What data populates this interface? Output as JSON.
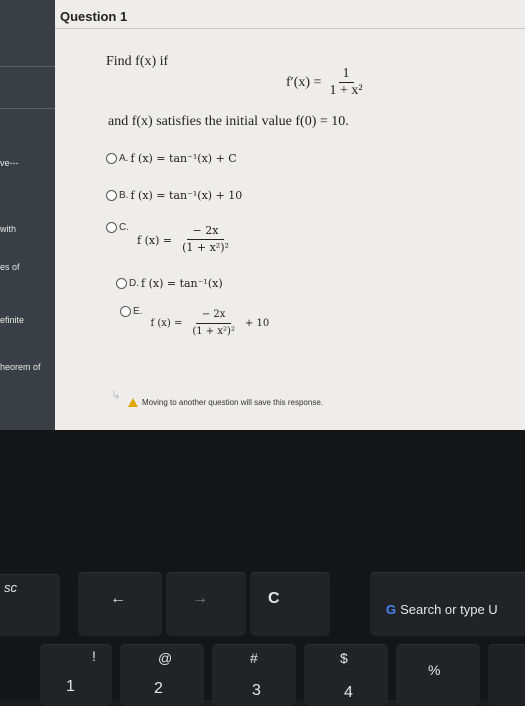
{
  "sidebar": {
    "items": [
      "ve---",
      "with",
      "es of",
      "efinite",
      "heorem of"
    ]
  },
  "question": {
    "title": "Question 1",
    "prompt": "Find f(x) if",
    "derivative_lhs": "f′(x) =",
    "derivative_num": "1",
    "derivative_den": "1 + x²",
    "condition": "and f(x) satisfies the initial value f(0) = 10."
  },
  "options": [
    {
      "letter": "A.",
      "expr": "f (x)  =  tan⁻¹(x)  +  C"
    },
    {
      "letter": "B.",
      "expr": "f (x)  =  tan⁻¹(x)  +  10"
    },
    {
      "letter": "C.",
      "lhs": "f (x)  =",
      "num": "− 2x",
      "den": "(1 + x²)²"
    },
    {
      "letter": "D.",
      "expr": "f (x)  =  tan⁻¹(x)"
    },
    {
      "letter": "E.",
      "lhs": "f (x)  =",
      "num": "− 2x",
      "den": "(1 + x²)²",
      "tail": "+ 10"
    }
  ],
  "notice": "Moving to another question will save this response.",
  "keyboard": {
    "esc": "sc",
    "back": "←",
    "forward": "→",
    "reload": "C",
    "search": "Search or type U",
    "row2": [
      "!",
      "@",
      "#",
      "$",
      "%"
    ],
    "row2b": [
      "1",
      "2",
      "3",
      "4"
    ]
  }
}
